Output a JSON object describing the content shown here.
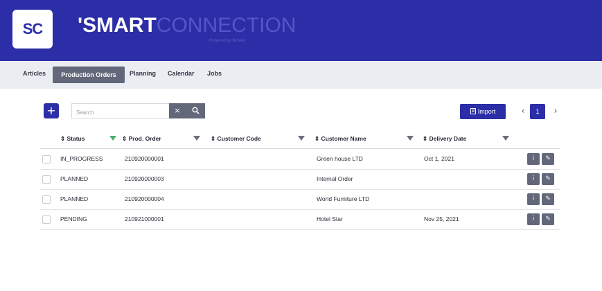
{
  "header": {
    "logo_text": "SC",
    "brand_bold": "'SMART",
    "brand_light": "CONNECTION",
    "brand_sub": "Powered by Beheer"
  },
  "nav": {
    "items": [
      "Articles",
      "Production Orders",
      "Planning",
      "Calendar",
      "Jobs"
    ],
    "active": "Production Orders"
  },
  "toolbar": {
    "add_label": "+",
    "search_placeholder": "Search",
    "clear_label": "×",
    "import_label": "Import",
    "page_prev": "‹",
    "page_current": "1",
    "page_next": "›"
  },
  "table": {
    "columns": [
      "Status",
      "Prod. Order",
      "Customer Code",
      "Customer Name",
      "Delivery Date"
    ],
    "rows": [
      {
        "status": "IN_PROGRESS",
        "prod_order": "210920000001",
        "customer_code": "",
        "customer_name": "Green house LTD",
        "delivery_date": "Oct 1, 2021"
      },
      {
        "status": "PLANNED",
        "prod_order": "210920000003",
        "customer_code": "",
        "customer_name": "Internal Order",
        "delivery_date": ""
      },
      {
        "status": "PLANNED",
        "prod_order": "210920000004",
        "customer_code": "",
        "customer_name": "World Furniture LTD",
        "delivery_date": ""
      },
      {
        "status": "PENDING",
        "prod_order": "210921000001",
        "customer_code": "",
        "customer_name": "Hotel Star",
        "delivery_date": "Nov 25, 2021"
      }
    ],
    "row_actions": [
      "info-icon",
      "edit-icon"
    ]
  },
  "colors": {
    "brand": "#2b2ea6",
    "button_gray": "#62677a",
    "filter_active": "#4caf72"
  }
}
